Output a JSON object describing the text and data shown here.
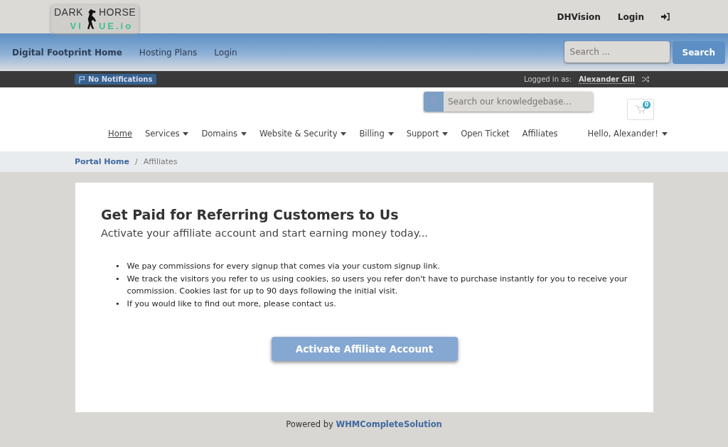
{
  "logo": {
    "top": [
      "DARK",
      "HORSE"
    ],
    "bottom": [
      "VI",
      "UE.io"
    ]
  },
  "top_links": [
    "DHVision",
    "Login"
  ],
  "main_nav": [
    "Digital Footprint Home",
    "Hosting Plans",
    "Login"
  ],
  "site_search": {
    "placeholder": "Search ...",
    "button": "Search"
  },
  "notifications": "No Notifications",
  "logged_in": {
    "label": "Logged in as:",
    "name": "Alexander Gill"
  },
  "kb_search": {
    "placeholder": "Search our knowledgebase..."
  },
  "cart": {
    "count": "0"
  },
  "menu": [
    {
      "label": "Home",
      "kind": "link",
      "selected": true
    },
    {
      "label": "Services",
      "kind": "dropdown",
      "selected": false
    },
    {
      "label": "Domains",
      "kind": "dropdown",
      "selected": false
    },
    {
      "label": "Website & Security",
      "kind": "dropdown",
      "selected": false
    },
    {
      "label": "Billing",
      "kind": "dropdown",
      "selected": false
    },
    {
      "label": "Support",
      "kind": "dropdown",
      "selected": false
    },
    {
      "label": "Open Ticket",
      "kind": "link",
      "selected": false
    },
    {
      "label": "Affiliates",
      "kind": "link",
      "selected": false
    }
  ],
  "account_menu": "Hello, Alexander!",
  "breadcrumb": [
    {
      "label": "Portal Home",
      "kind": "link"
    },
    {
      "label": "Affiliates",
      "kind": "current"
    }
  ],
  "breadcrumb_separator": "/",
  "bullet_marker": "•",
  "card": {
    "title": "Get Paid for Referring Customers to Us",
    "subtitle": "Activate your affiliate account and start earning money today...",
    "bullets": [
      "We pay commissions for every signup that comes via your custom signup link.",
      "We track the visitors you refer to us using cookies, so users you refer don't have to purchase instantly for you to receive your commission. Cookies last for up to 90 days following the initial visit.",
      "If you would like to find out more, please contact us."
    ],
    "button": "Activate Affiliate Account"
  },
  "footer": {
    "text": "Powered by",
    "link": "WHMCompleteSolution"
  }
}
